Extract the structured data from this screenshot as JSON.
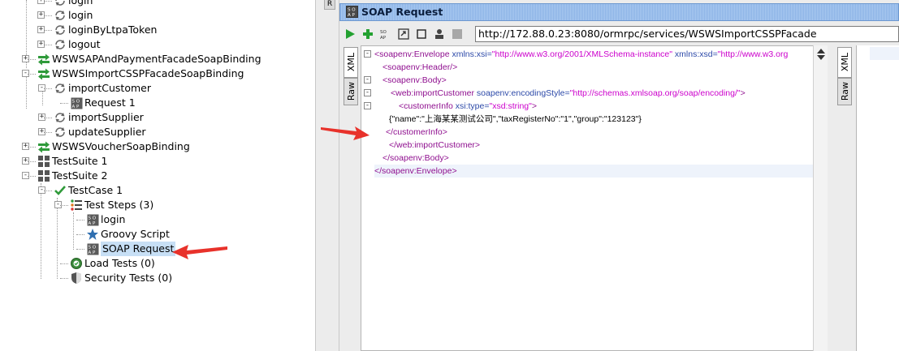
{
  "navigator": {
    "items": [
      {
        "label": "login",
        "level": 3,
        "icon": "operation-icon"
      },
      {
        "label": "login",
        "level": 3,
        "icon": "operation-icon"
      },
      {
        "label": "loginByLtpaToken",
        "level": 3,
        "icon": "operation-icon"
      },
      {
        "label": "logout",
        "level": 3,
        "icon": "operation-icon"
      },
      {
        "label": "WSWSAPAndPaymentFacadeSoapBinding",
        "level": 1,
        "icon": "interface-icon"
      },
      {
        "label": "WSWSImportCSSPFacadeSoapBinding",
        "level": 1,
        "icon": "interface-icon"
      },
      {
        "label": "importCustomer",
        "level": 2,
        "icon": "operation-icon"
      },
      {
        "label": "Request 1",
        "level": 3,
        "icon": "soap-icon"
      },
      {
        "label": "importSupplier",
        "level": 2,
        "icon": "operation-icon"
      },
      {
        "label": "updateSupplier",
        "level": 2,
        "icon": "operation-icon"
      },
      {
        "label": "WSWSVoucherSoapBinding",
        "level": 1,
        "icon": "interface-icon"
      },
      {
        "label": "TestSuite 1",
        "level": 1,
        "icon": "testsuite-icon"
      },
      {
        "label": "TestSuite 2",
        "level": 1,
        "icon": "testsuite-icon"
      },
      {
        "label": "TestCase 1",
        "level": 2,
        "icon": "check-icon"
      },
      {
        "label": "Test Steps (3)",
        "level": 3,
        "icon": "steps-icon"
      },
      {
        "label": "login",
        "level": 4,
        "icon": "soap-icon"
      },
      {
        "label": "Groovy Script",
        "level": 4,
        "icon": "star-icon"
      },
      {
        "label": "SOAP Request",
        "level": 4,
        "icon": "soap-icon"
      },
      {
        "label": "Load Tests (0)",
        "level": 3,
        "icon": "load-icon"
      },
      {
        "label": "Security Tests (0)",
        "level": 3,
        "icon": "shield-icon"
      }
    ]
  },
  "split_tab_label": "R",
  "window": {
    "title": "SOAP Request",
    "endpoint_url": "http://172.88.0.23:8080/ormrpc/services/WSWSImportCSSPFacade",
    "request_tabs": [
      "XML",
      "Raw"
    ],
    "response_tabs": [
      "XML",
      "Raw"
    ]
  },
  "xml_lines": [
    {
      "indent": 0,
      "fold": "minus",
      "parts": [
        {
          "t": "tag",
          "v": "<soapenv:Envelope "
        },
        {
          "t": "attr",
          "v": "xmlns:xsi="
        },
        {
          "t": "val",
          "v": "\"http://www.w3.org/2001/XMLSchema-instance\" "
        },
        {
          "t": "attr",
          "v": "xmlns:xsd="
        },
        {
          "t": "val",
          "v": "\"http://www.w3.org"
        }
      ]
    },
    {
      "indent": 1,
      "fold": "",
      "parts": [
        {
          "t": "tag",
          "v": "<soapenv:Header/>"
        }
      ]
    },
    {
      "indent": 1,
      "fold": "minus",
      "parts": [
        {
          "t": "tag",
          "v": "<soapenv:Body>"
        }
      ]
    },
    {
      "indent": 2,
      "fold": "minus",
      "parts": [
        {
          "t": "tag",
          "v": "<web:importCustomer "
        },
        {
          "t": "attr",
          "v": "soapenv:encodingStyle="
        },
        {
          "t": "val",
          "v": "\"http://schemas.xmlsoap.org/soap/encoding/\""
        },
        {
          "t": "tag",
          "v": ">"
        }
      ]
    },
    {
      "indent": 3,
      "fold": "minus",
      "parts": [
        {
          "t": "tag",
          "v": "<customerInfo "
        },
        {
          "t": "attr",
          "v": "xsi:type="
        },
        {
          "t": "val",
          "v": "\"xsd:string\""
        },
        {
          "t": "tag",
          "v": ">"
        }
      ]
    },
    {
      "indent": 2,
      "fold": "",
      "parts": [
        {
          "t": "text",
          "v": "{\"name\":\"上海某某测试公司\",\"taxRegisterNo\":\"1\",\"group\":\"123123\"}"
        }
      ]
    },
    {
      "indent": 2,
      "fold": "",
      "parts": [
        {
          "t": "tag",
          "v": "</customerInfo>"
        }
      ]
    },
    {
      "indent": 2,
      "fold": "",
      "parts": [
        {
          "t": "tag",
          "v": "</web:importCustomer>"
        }
      ]
    },
    {
      "indent": 1,
      "fold": "",
      "parts": [
        {
          "t": "tag",
          "v": "</soapenv:Body>"
        }
      ]
    },
    {
      "indent": 0,
      "fold": "",
      "parts": [
        {
          "t": "tag",
          "v": "</soapenv:Envelope>"
        }
      ]
    }
  ],
  "colors": {
    "tag": "#8f0f8f",
    "attr": "#2c49a8",
    "val": "#cc00cc",
    "selection": "#c7dff5",
    "annotation_arrow": "#e8322b"
  }
}
